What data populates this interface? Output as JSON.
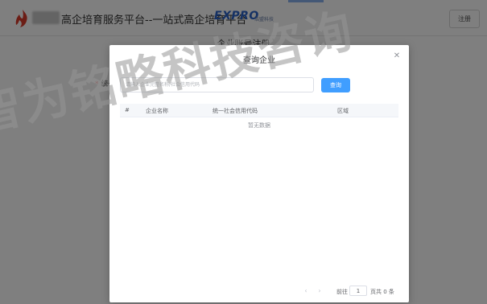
{
  "header": {
    "site_title": "高企培育服务平台--一站式高企培育平台",
    "brand_name": "EXPRO",
    "brand_sub": "浩盟科技",
    "register_label": "注册"
  },
  "page": {
    "heading": "企业账号注册",
    "form_label": "统一"
  },
  "dialog": {
    "title": "查询企业",
    "close_icon": "close-icon",
    "search": {
      "placeholder": "请输入企业完整名称/社会信用代码",
      "value": ""
    },
    "query_label": "查询",
    "table": {
      "columns": [
        "#",
        "企业名称",
        "统一社会信用代码",
        "区域"
      ],
      "rows": [],
      "empty_text": "暂无数据"
    },
    "pagination": {
      "goto_label": "前往",
      "page_value": "1",
      "total_label": "页共 0 条"
    }
  },
  "watermark": "智为铭略科技咨询",
  "colors": {
    "primary": "#409eff",
    "brand": "#2b62c8",
    "overlay": "rgba(0,0,0,0.5)"
  }
}
